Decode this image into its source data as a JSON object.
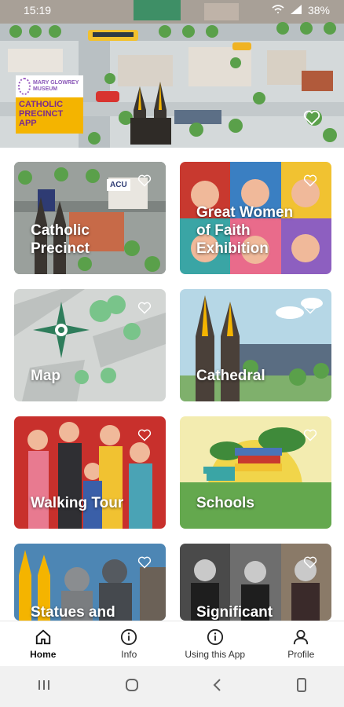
{
  "status_bar": {
    "time": "15:19",
    "battery": "38%"
  },
  "brand": {
    "museum_name": "MARY GLOWREY MUSEUM",
    "app_name": "CATHOLIC PRECINCT APP",
    "accent": "#f4b400",
    "purple": "#7b2a8e"
  },
  "tiles": [
    {
      "label": "Catholic\nPrecinct",
      "icon": "heart-icon"
    },
    {
      "label": "Great Women\nof Faith\nExhibition",
      "icon": "heart-icon"
    },
    {
      "label": "Map",
      "icon": "heart-icon"
    },
    {
      "label": "Cathedral",
      "icon": "heart-icon"
    },
    {
      "label": "Walking Tour",
      "icon": "heart-icon"
    },
    {
      "label": "Schools",
      "icon": "heart-icon"
    },
    {
      "label": "Statues and",
      "icon": "heart-icon"
    },
    {
      "label": "Significant",
      "icon": "heart-icon"
    }
  ],
  "tile_badge": "ACU",
  "nav": {
    "home": "Home",
    "info": "Info",
    "using": "Using this App",
    "profile": "Profile"
  }
}
